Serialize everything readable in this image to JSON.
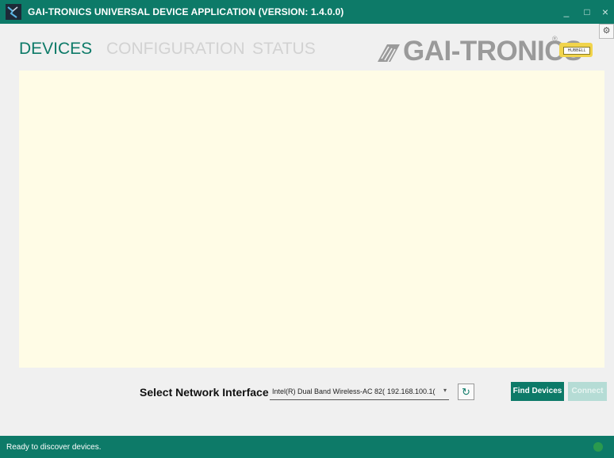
{
  "window": {
    "title": "GAI-TRONICS UNIVERSAL DEVICE APPLICATION (VERSION: 1.4.0.0)",
    "minimize_glyph": "_",
    "maximize_glyph": "□",
    "close_glyph": "×"
  },
  "tabs": [
    {
      "label": "DEVICES",
      "active": true
    },
    {
      "label": "CONFIGURATION",
      "active": false
    },
    {
      "label": "STATUS",
      "active": false
    }
  ],
  "logo": {
    "text": "GAI-TRONICS",
    "registered": "®",
    "badge": "HUBBELL"
  },
  "icons": {
    "app": "app-icon",
    "settings": "gear-icon",
    "refresh": "refresh-icon",
    "connection_status": "status-indicator-icon"
  },
  "network": {
    "label": "Select Network Interface",
    "selected_adapter": "Intel(R) Dual Band Wireless-AC 82(",
    "selected_ip": "192.168.100.1(",
    "dropdown_glyph": "▾"
  },
  "buttons": {
    "find_devices": "Find Devices",
    "connect": "Connect",
    "refresh_glyph": "↻",
    "settings_glyph": "⚙"
  },
  "status": {
    "text": "Ready to discover devices.",
    "indicator_color": "#2a9a4e"
  },
  "colors": {
    "brand": "#0d7a68",
    "device_area": "#fffce6",
    "inactive_tab": "#d2d2d2"
  }
}
